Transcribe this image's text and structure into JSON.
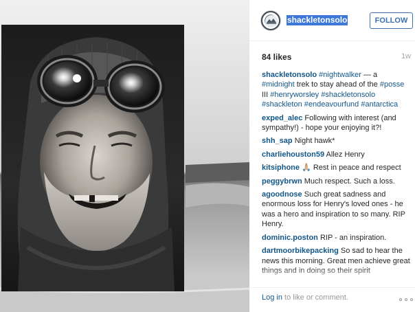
{
  "post": {
    "username": "shackletonsolo",
    "follow_label": "FOLLOW",
    "likes": "84 likes",
    "age": "1w",
    "caption": {
      "segments": [
        {
          "text": "#nightwalker",
          "kind": "tag"
        },
        {
          "text": " — a ",
          "kind": "text"
        },
        {
          "text": "#midnight",
          "kind": "tag"
        },
        {
          "text": " trek to stay ahead of the ",
          "kind": "text"
        },
        {
          "text": "#posse",
          "kind": "tag"
        },
        {
          "text": " III ",
          "kind": "text"
        },
        {
          "text": "#henryworsley",
          "kind": "tag"
        },
        {
          "text": " ",
          "kind": "text"
        },
        {
          "text": "#shackletonsolo",
          "kind": "tag"
        },
        {
          "text": " ",
          "kind": "text"
        },
        {
          "text": "#shackleton",
          "kind": "tag"
        },
        {
          "text": " ",
          "kind": "text"
        },
        {
          "text": "#endeavourfund",
          "kind": "tag"
        },
        {
          "text": " ",
          "kind": "text"
        },
        {
          "text": "#antarctica",
          "kind": "tag"
        }
      ]
    }
  },
  "comments": [
    {
      "user": "exped_alec",
      "text": "Following with interest (and sympathy!) - hope your enjoying it?!"
    },
    {
      "user": "shh_sap",
      "text": "Night hawk*"
    },
    {
      "user": "charliehouston59",
      "text": "Allez Henry"
    },
    {
      "user": "kitsiphone",
      "text": "🙏🏼 Rest in peace and respect"
    },
    {
      "user": "peggybrwn",
      "text": "Much respect. Such a loss."
    },
    {
      "user": "agoodnose",
      "text": "Such great sadness and enormous loss for Henry's loved ones - he was a hero and inspiration to so many. RIP Henry."
    },
    {
      "user": "dominic.poston",
      "text": "RIP - an inspiration."
    },
    {
      "user": "dartmoorbikepacking",
      "text": "So sad to hear the news this morning. Great men achieve great things and in doing so their spirit"
    }
  ],
  "footer": {
    "login_link": "Log in",
    "login_rest": " to like or comment."
  },
  "colors": {
    "link": "#125688",
    "follow": "#3b6fb1",
    "highlight": "#3b78d8"
  },
  "icons": {
    "avatar": "expedition-badge-icon",
    "more": "more-options-icon"
  }
}
